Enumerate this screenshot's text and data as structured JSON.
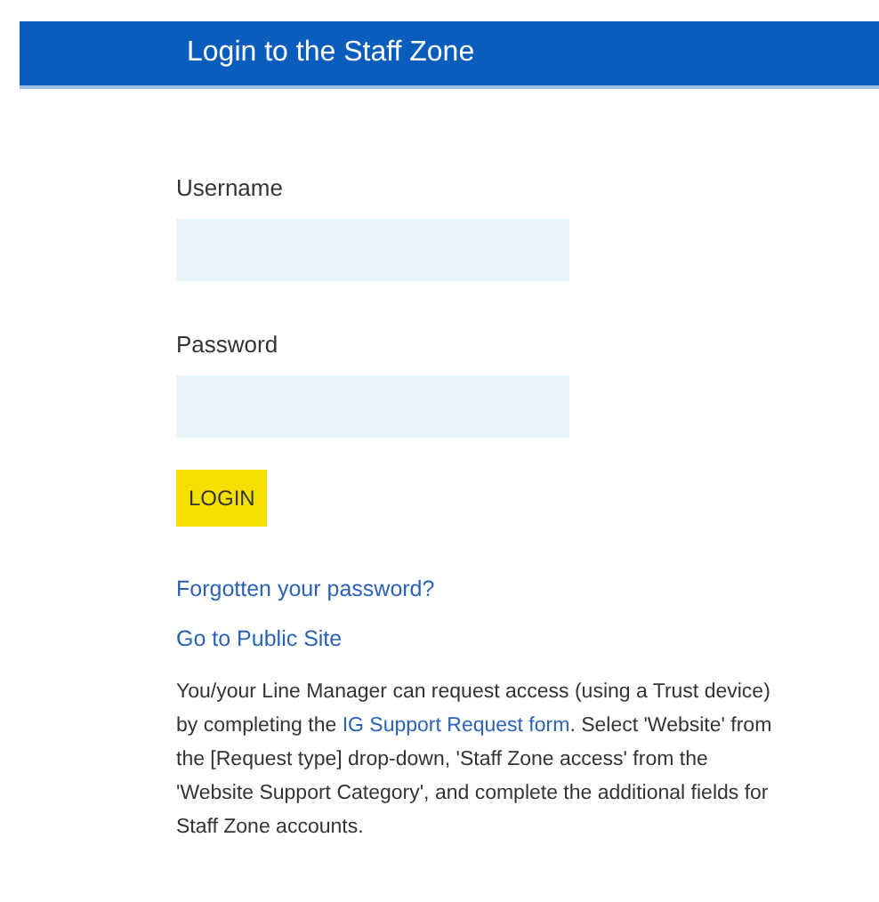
{
  "header": {
    "title": "Login to the Staff Zone"
  },
  "fields": [
    {
      "label": "Username"
    },
    {
      "label": "Password"
    }
  ],
  "login_button": "LOGIN",
  "links": [
    "Forgotten your password?",
    "Go to Public Site"
  ],
  "info": {
    "before": "You/your Line Manager can request access (using a Trust device) by completing the ",
    "link": "IG Support Request form",
    "after": ". Select 'Website' from the [Request type] drop-down, 'Staff Zone access' from the 'Website Support Category', and complete the additional fields for Staff Zone accounts."
  }
}
